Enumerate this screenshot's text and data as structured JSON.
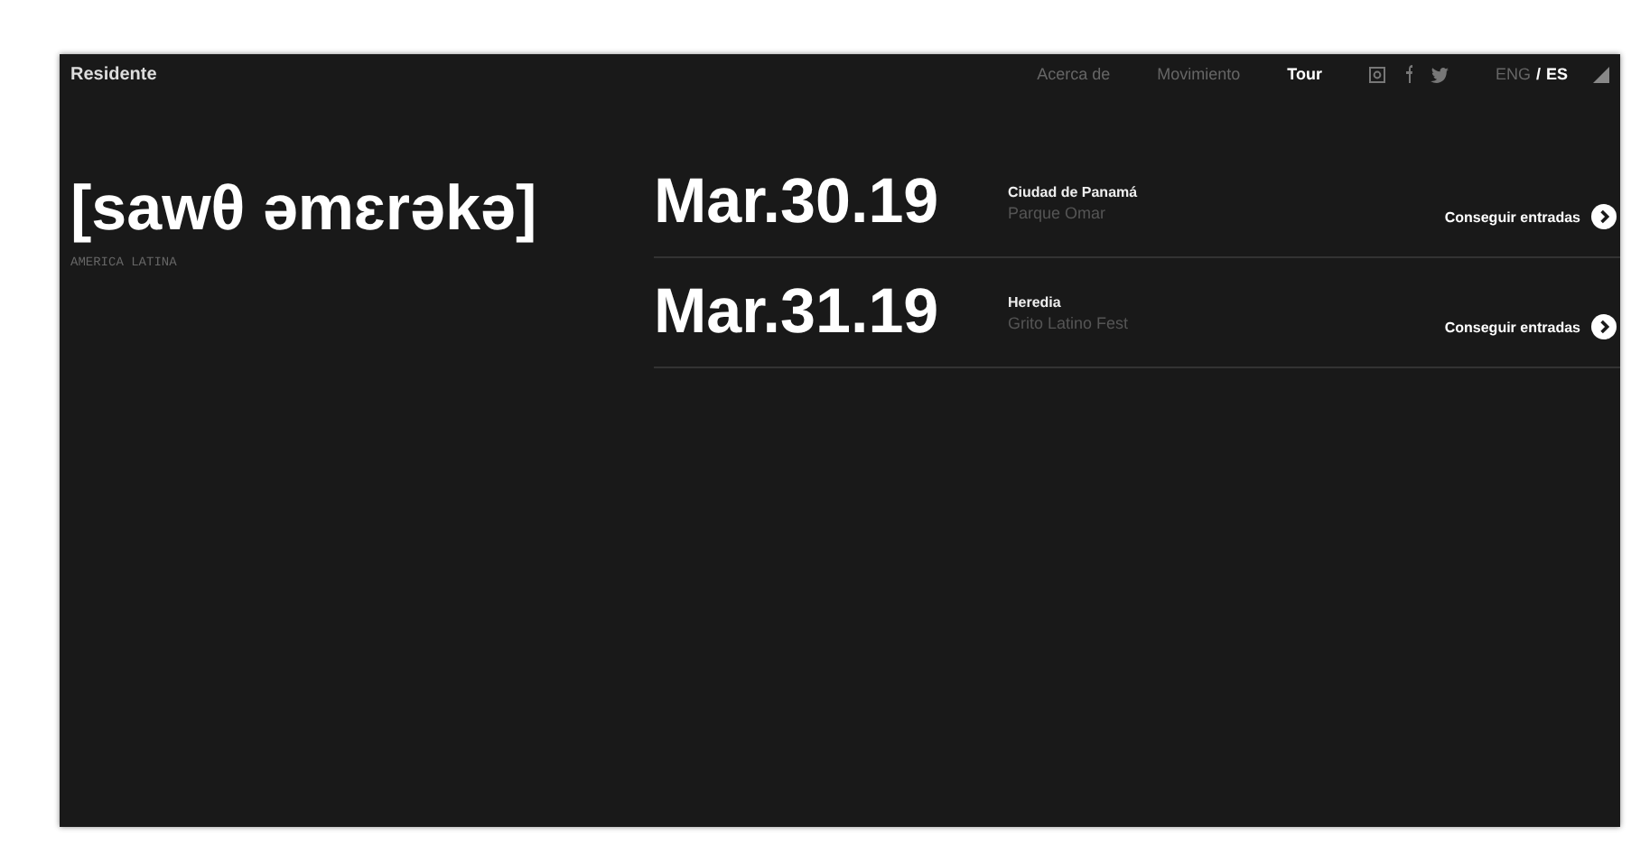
{
  "brand": "Residente",
  "nav": [
    {
      "label": "Acerca de",
      "selected": false
    },
    {
      "label": "Movimiento",
      "selected": false
    },
    {
      "label": "Tour",
      "selected": true
    }
  ],
  "languages": {
    "separator": "/",
    "items": [
      {
        "label": "ENG",
        "selected": false
      },
      {
        "label": "ES",
        "selected": true
      }
    ]
  },
  "hero": {
    "title": "[sawθ əmɛrəkə]",
    "subtitle": "AMERICA LATINA"
  },
  "events": [
    {
      "date": "Mar.30.19",
      "city": "Ciudad de Panamá",
      "venue": "Parque Omar",
      "action": "Conseguir entradas"
    },
    {
      "date": "Mar.31.19",
      "city": "Heredia",
      "venue": "Grito Latino Fest",
      "action": "Conseguir entradas"
    }
  ]
}
